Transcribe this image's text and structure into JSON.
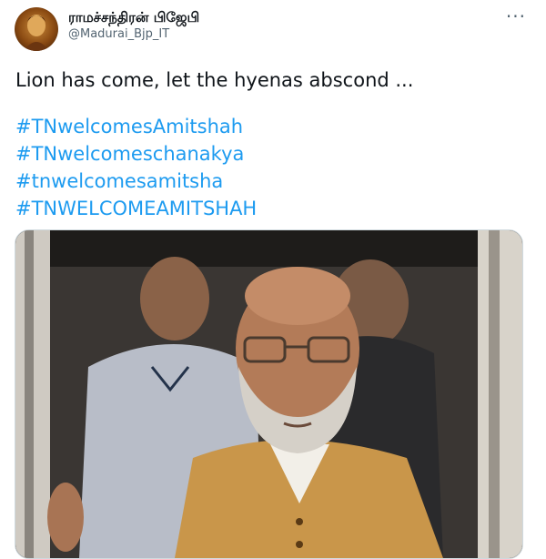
{
  "author": {
    "display_name": "ராமச்சந்திரன் பிஜேபி",
    "handle": "@Madurai_Bjp_IT",
    "avatar_icon": "profile-avatar"
  },
  "more_options": {
    "label": "···",
    "icon": "more-icon"
  },
  "tweet": {
    "text": "Lion has come, let the hyenas abscond ...",
    "hashtags": [
      "#TNwelcomesAmitshah",
      "#TNwelcomeschanakya",
      "#tnwelcomesamitsha",
      "#TNWELCOMEAMITSHAH"
    ]
  },
  "colors": {
    "link": "#1d9bf0",
    "text": "#0f1419",
    "secondary": "#536471",
    "border": "#cfd9de"
  }
}
